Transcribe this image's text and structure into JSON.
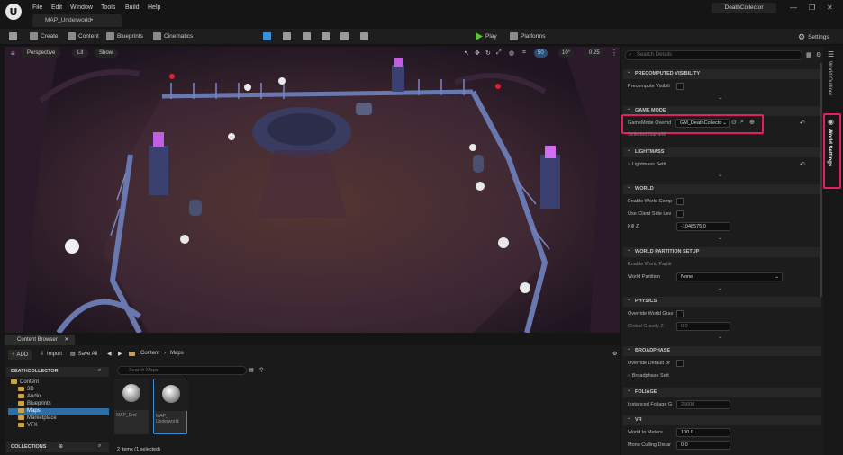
{
  "titlebar": {
    "menus": [
      "File",
      "Edit",
      "Window",
      "Tools",
      "Build",
      "Help"
    ],
    "map_tab": "MAP_Underworld•",
    "project": "DeathCollector"
  },
  "toolbar": {
    "create": "Create",
    "content": "Content",
    "blueprints": "Blueprints",
    "cinematics": "Cinematics",
    "play": "Play",
    "platforms": "Platforms",
    "settings": "Settings"
  },
  "viewport": {
    "perspective": "Perspective",
    "lit": "Lit",
    "show": "Show",
    "grid_snap": "50",
    "rot_snap": "10°",
    "scale_snap": "0.25"
  },
  "content_browser": {
    "tab": "Content Browser",
    "add": "ADD",
    "import": "Import",
    "save_all": "Save All",
    "crumb_content": "Content",
    "crumb_maps": "Maps",
    "project_header": "DEATHCOLLECTOR",
    "search_placeholder": "Search Maps",
    "tree": [
      "Content",
      "3D",
      "Audio",
      "Blueprints",
      "Maps",
      "Marketplace",
      "VFX"
    ],
    "collections": "COLLECTIONS",
    "assets": [
      {
        "name": "MAP_End"
      },
      {
        "name": "MAP_\nUnderworld"
      }
    ],
    "status": "2 items (1 selected)"
  },
  "details": {
    "search_placeholder": "Search Details",
    "sections": {
      "precomputed": "PRECOMPUTED VISIBILITY",
      "game_mode": "GAME MODE",
      "lightmass": "LIGHTMASS",
      "world": "WORLD",
      "world_partition": "WORLD PARTITION SETUP",
      "physics": "PHYSICS",
      "broadphase": "BROADPHASE",
      "foliage": "FOLIAGE",
      "vr": "VR"
    },
    "props": {
      "precompute_visibility": "Precompute Visibili",
      "gamemode_override": "GameMode Overrid",
      "gamemode_value": "GM_DeathCollecto",
      "selected_gamemode": "Selected GameM",
      "lightmass_settings": "Lightmass Setti",
      "enable_world_comp": "Enable World Comp",
      "use_client_side": "Use Client Side Lev",
      "kill_z": "Kill Z",
      "kill_z_value": "-1048575.0",
      "enable_world_partition": "Enable World Partiti",
      "world_partition": "World Partition",
      "world_partition_value": "None",
      "override_world_gravity": "Override World Grav",
      "global_gravity_z": "Global Gravity Z",
      "global_gravity_value": "0.0",
      "override_default_br": "Override Default Br",
      "broadphase_settings": "Broadphase Sett",
      "instanced_foliage": "Instanced Foliage G",
      "instanced_foliage_value": "25600",
      "world_to_meters": "World to Meters",
      "world_to_meters_value": "100.0",
      "mono_culling": "Mono Culling Distar",
      "mono_culling_value": "0.0"
    }
  },
  "side_tabs": {
    "outliner": "World Outliner",
    "world_settings": "World Settings"
  },
  "colors": {
    "highlight": "#e4205a",
    "play_green": "#5ec23a",
    "folder": "#c9a24f",
    "selection": "#2c6ea5"
  }
}
